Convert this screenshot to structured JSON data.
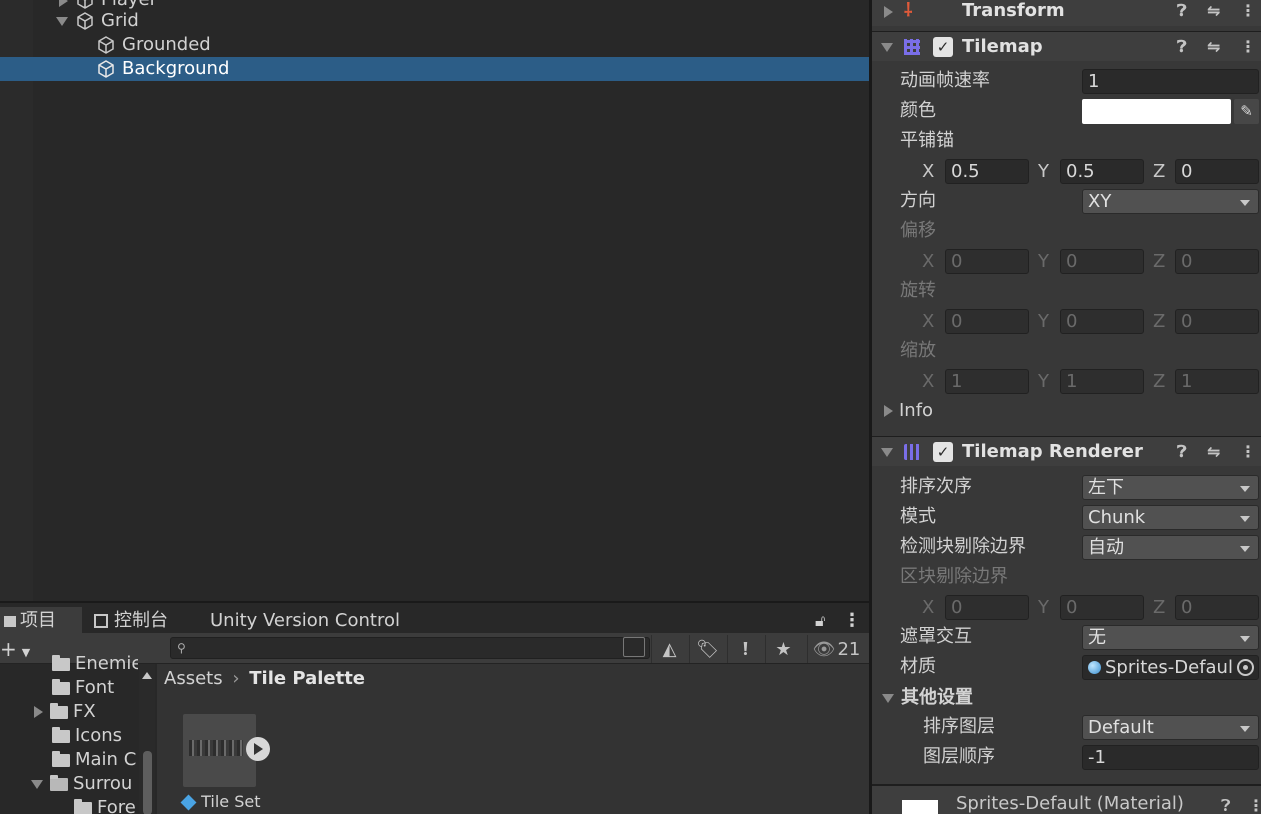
{
  "hierarchy": {
    "items": [
      {
        "label": "Player"
      },
      {
        "label": "Grid"
      },
      {
        "label": "Grounded"
      },
      {
        "label": "Background"
      }
    ]
  },
  "project": {
    "tabs": [
      "项目",
      "控制台",
      "Unity Version Control"
    ],
    "visibility_count": "21",
    "folders": [
      "Enemies",
      "Font",
      "FX",
      "Icons",
      "Main C",
      "Surrou",
      "Fore"
    ],
    "breadcrumb": {
      "root": "Assets",
      "current": "Tile Palette"
    },
    "assets": [
      {
        "label": "Tile Set"
      }
    ]
  },
  "inspector": {
    "transform": {
      "title": "Transform"
    },
    "tilemap": {
      "title": "Tilemap",
      "anim_rate_label": "动画帧速率",
      "anim_rate_value": "1",
      "color_label": "颜色",
      "color_value": "#ffffff",
      "anchor_label": "平铺锚",
      "anchor": {
        "x": "0.5",
        "y": "0.5",
        "z": "0"
      },
      "orientation_label": "方向",
      "orientation_value": "XY",
      "offset_label": "偏移",
      "offset": {
        "x": "0",
        "y": "0",
        "z": "0"
      },
      "rotation_label": "旋转",
      "rotation": {
        "x": "0",
        "y": "0",
        "z": "0"
      },
      "scale_label": "缩放",
      "scale": {
        "x": "1",
        "y": "1",
        "z": "1"
      },
      "info_label": "Info"
    },
    "renderer": {
      "title": "Tilemap Renderer",
      "sort_order_label": "排序次序",
      "sort_order_value": "左下",
      "mode_label": "模式",
      "mode_value": "Chunk",
      "detect_bounds_label": "检测块剔除边界",
      "detect_bounds_value": "自动",
      "chunk_bounds_label": "区块剔除边界",
      "chunk_bounds": {
        "x": "0",
        "y": "0",
        "z": "0"
      },
      "mask_label": "遮罩交互",
      "mask_value": "无",
      "material_label": "材质",
      "material_value": "Sprites-Default",
      "additional_label": "其他设置",
      "sorting_layer_label": "排序图层",
      "sorting_layer_value": "Default",
      "order_label": "图层顺序",
      "order_value": "-1"
    },
    "material_footer": "Sprites-Default (Material)",
    "axis": {
      "x": "X",
      "y": "Y",
      "z": "Z"
    }
  }
}
